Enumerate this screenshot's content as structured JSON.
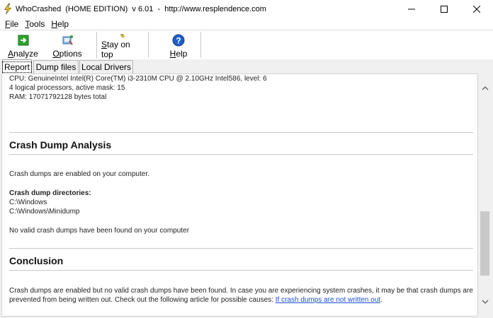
{
  "window": {
    "title": "WhoCrashed  (HOME EDITION)  v 6.01  -  http://www.resplendence.com"
  },
  "menu": [
    {
      "accel": "F",
      "rest": "ile"
    },
    {
      "accel": "T",
      "rest": "ools"
    },
    {
      "accel": "H",
      "rest": "elp"
    }
  ],
  "toolbar": {
    "analyze": {
      "accel": "A",
      "rest": "nalyze"
    },
    "options": {
      "accel": "O",
      "rest": "ptions"
    },
    "stay_on_top": {
      "accel": "S",
      "rest": "tay on top"
    },
    "help": {
      "accel": "H",
      "rest": "elp"
    }
  },
  "tabs": [
    "Report",
    "Dump files",
    "Local Drivers"
  ],
  "report": {
    "system": {
      "cpu": "CPU: GenuineIntel Intel(R) Core(TM) i3-2310M CPU @ 2.10GHz Intel586, level: 6",
      "processors": "4 logical processors, active mask: 15",
      "ram": "RAM: 17071792128 bytes total"
    },
    "crash_dump_analysis": {
      "heading": "Crash Dump Analysis",
      "enabled_text": "Crash dumps are enabled on your computer.",
      "dirs_label": "Crash dump directories:",
      "dir1": "C:\\Windows",
      "dir2": "C:\\Windows\\Minidump",
      "none_found": "No valid crash dumps have been found on your computer"
    },
    "conclusion": {
      "heading": "Conclusion",
      "text": "Crash dumps are enabled but no valid crash dumps have been found. In case you are experiencing system crashes, it may be that crash dumps are prevented from being written out. Check out the following article for possible causes: ",
      "link_text": "If crash dumps are not written out",
      "trailing": "."
    }
  },
  "colors": {
    "link": "#1a4fd6",
    "help_icon": "#1f5fc8",
    "stay_on_top_icon": "#f2d21a",
    "analyze_icon": "#2aa52a"
  }
}
